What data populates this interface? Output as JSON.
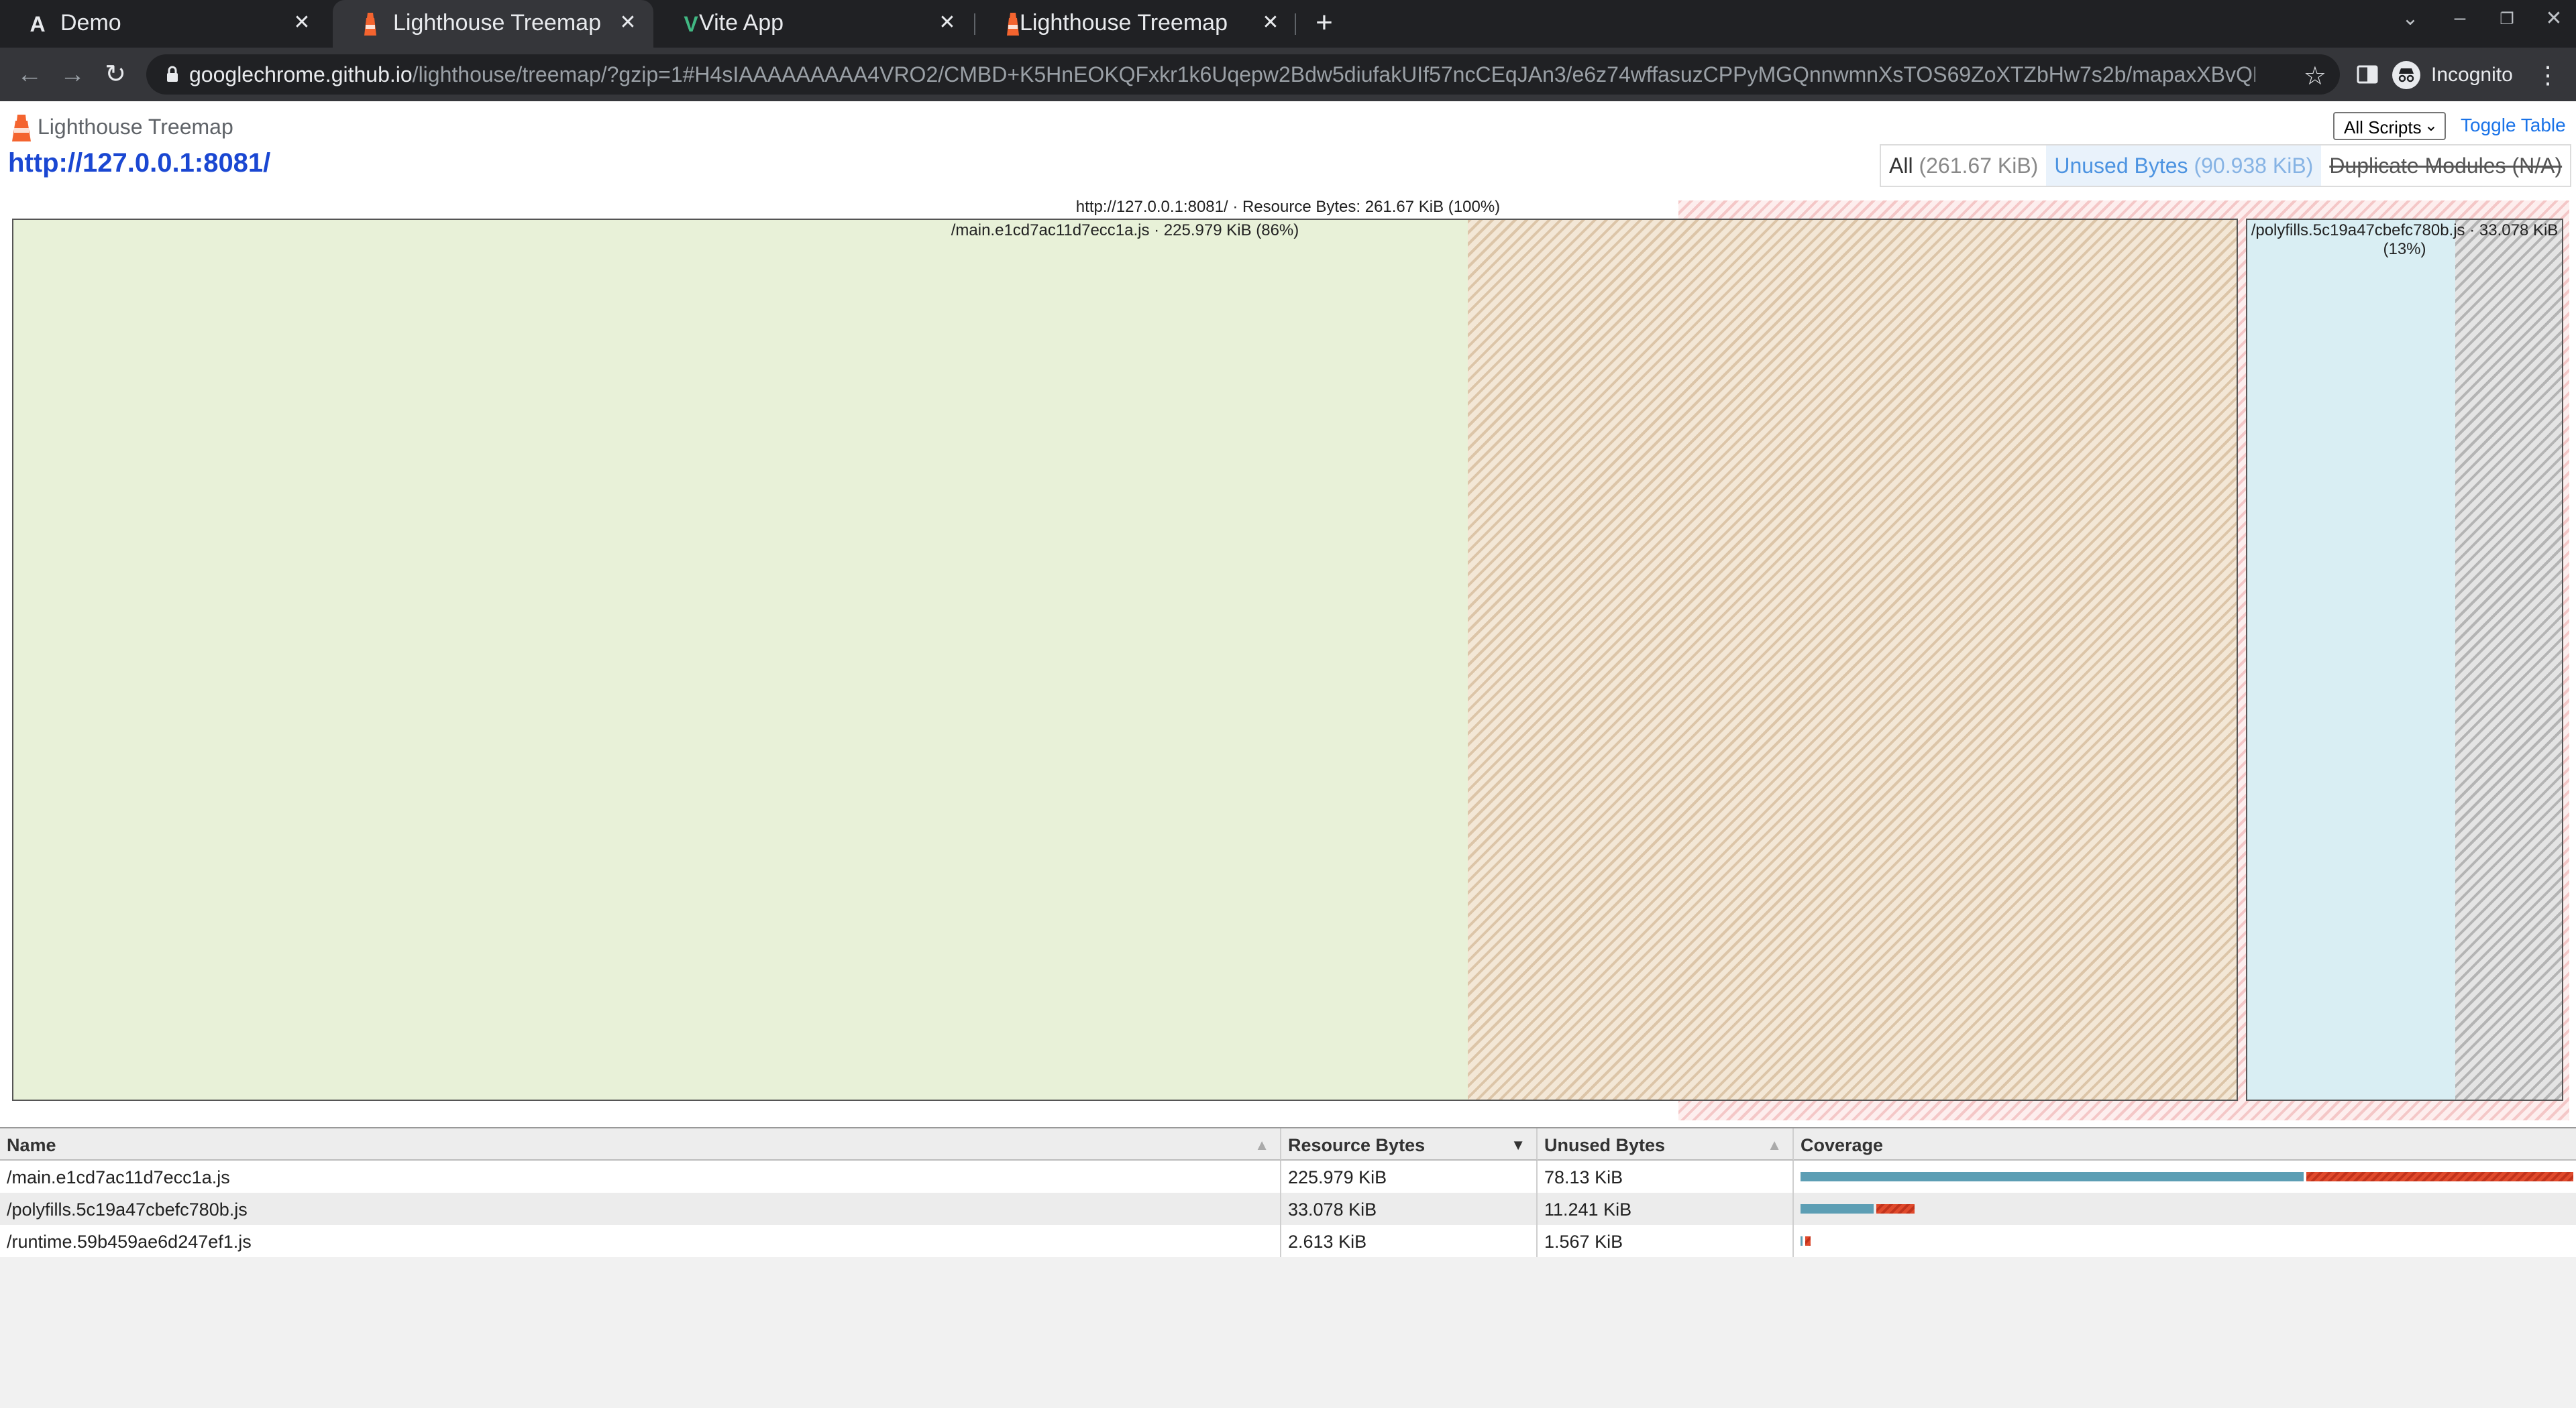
{
  "browser": {
    "tabs": [
      {
        "title": "Demo",
        "favicon": "letter-a-icon",
        "favicon_glyph": "A",
        "active": false
      },
      {
        "title": "Lighthouse Treemap",
        "favicon": "lighthouse-icon",
        "active": true
      },
      {
        "title": "Vite App",
        "favicon": "vite-icon",
        "favicon_glyph": "V",
        "active": false
      },
      {
        "title": "Lighthouse Treemap",
        "favicon": "lighthouse-icon",
        "active": false
      }
    ],
    "url_host": "googlechrome.github.io",
    "url_path": "/lighthouse/treemap/?gzip=1#H4sIAAAAAAAAA4VRO2/CMBD+K5HnEOKQFxkr1k6Uqepw2Bdw5diufakUIf57ncCEqJAn3/e6z74wffasuzCPPyMGQnnwmnXsTOS69ZoXTZbHw7s2b/mapaxXBvQLDoxSUZhdg/DK0...",
    "incognito_label": "Incognito",
    "accent_orange": "#f4642f"
  },
  "header": {
    "app_title": "Lighthouse Treemap",
    "page_url": "http://127.0.0.1:8081/",
    "scripts_select_value": "All Scripts",
    "toggle_table_label": "Toggle Table",
    "view_modes": [
      {
        "label": "All",
        "sub": "(261.67 KiB)",
        "state": "normal"
      },
      {
        "label": "Unused Bytes",
        "sub": "(90.938 KiB)",
        "state": "selected"
      },
      {
        "label": "Duplicate Modules",
        "sub": "(N/A)",
        "state": "disabled"
      }
    ]
  },
  "treemap": {
    "root_label": "http://127.0.0.1:8081/ · Resource Bytes: 261.67 KiB (100%)",
    "nodes": [
      {
        "label": "/main.e1cd7ac11d7ecc1a.js · 225.979 KiB (86%)",
        "color": "#e8f1d8",
        "unused_fraction": 0.3457
      },
      {
        "label": "/polyfills.5c19a47cbefc780b.js · 33.078 KiB (13%)",
        "color": "#d9eef3",
        "unused_fraction": 0.3398
      }
    ]
  },
  "table": {
    "columns": [
      {
        "label": "Name",
        "sort": "asc-inactive"
      },
      {
        "label": "Resource Bytes",
        "sort": "desc-active"
      },
      {
        "label": "Unused Bytes",
        "sort": "asc-inactive"
      },
      {
        "label": "Coverage",
        "sort": "none"
      }
    ],
    "rows": [
      {
        "name": "/main.e1cd7ac11d7ecc1a.js",
        "resource_bytes": "225.979 KiB",
        "unused_bytes": "78.13 KiB",
        "resource_kib": 225.979,
        "unused_kib": 78.13
      },
      {
        "name": "/polyfills.5c19a47cbefc780b.js",
        "resource_bytes": "33.078 KiB",
        "unused_bytes": "11.241 KiB",
        "resource_kib": 33.078,
        "unused_kib": 11.241
      },
      {
        "name": "/runtime.59b459ae6d247ef1.js",
        "resource_bytes": "2.613 KiB",
        "unused_bytes": "1.567 KiB",
        "resource_kib": 2.613,
        "unused_kib": 1.567
      }
    ],
    "coverage_colors": {
      "used": "#5c9eb4",
      "unused": "#e04a2c"
    }
  }
}
